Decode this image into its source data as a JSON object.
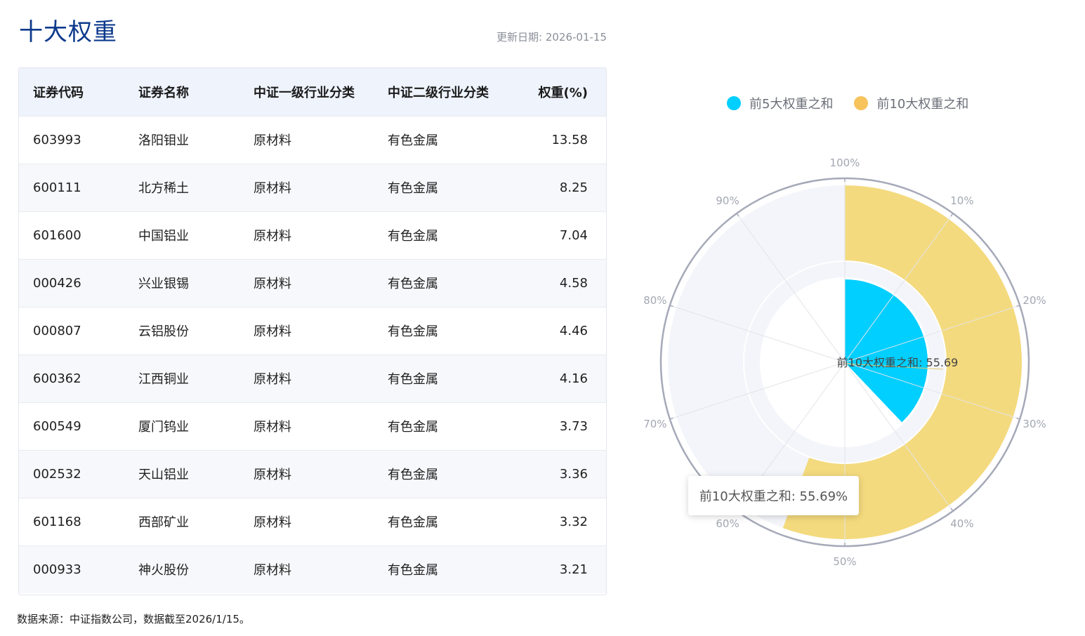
{
  "page": {
    "title": "十大权重",
    "update_date": "更新日期: 2026-01-15",
    "source_note": "数据来源：中证指数公司，数据截至2026/1/15。"
  },
  "table": {
    "headers": [
      "证券代码",
      "证券名称",
      "中证一级行业分类",
      "中证二级行业分类",
      "权重(%)"
    ],
    "rows": [
      [
        "603993",
        "洛阳钼业",
        "原材料",
        "有色金属",
        "13.58"
      ],
      [
        "600111",
        "北方稀土",
        "原材料",
        "有色金属",
        "8.25"
      ],
      [
        "601600",
        "中国铝业",
        "原材料",
        "有色金属",
        "7.04"
      ],
      [
        "000426",
        "兴业银锡",
        "原材料",
        "有色金属",
        "4.58"
      ],
      [
        "000807",
        "云铝股份",
        "原材料",
        "有色金属",
        "4.46"
      ],
      [
        "600362",
        "江西铜业",
        "原材料",
        "有色金属",
        "4.16"
      ],
      [
        "600549",
        "厦门钨业",
        "原材料",
        "有色金属",
        "3.73"
      ],
      [
        "002532",
        "天山铝业",
        "原材料",
        "有色金属",
        "3.36"
      ],
      [
        "601168",
        "西部矿业",
        "原材料",
        "有色金属",
        "3.32"
      ],
      [
        "000933",
        "神火股份",
        "原材料",
        "有色金属",
        "3.21"
      ]
    ]
  },
  "chart_data": {
    "type": "polar-bar",
    "legend_position": "top",
    "angle_axis": {
      "range": [
        0,
        100
      ],
      "tick_labels": [
        "100%",
        "10%",
        "20%",
        "30%",
        "40%",
        "50%",
        "60%",
        "70%",
        "80%",
        "90%"
      ]
    },
    "series": [
      {
        "name": "前5大权重之和",
        "value": 37.91,
        "color": "#00cfff"
      },
      {
        "name": "前10大权重之和",
        "value": 55.69,
        "color": "#f4da7e"
      }
    ],
    "center_label": "前10大权重之和: 55.69",
    "tooltip": "前10大权重之和: 55.69%"
  }
}
